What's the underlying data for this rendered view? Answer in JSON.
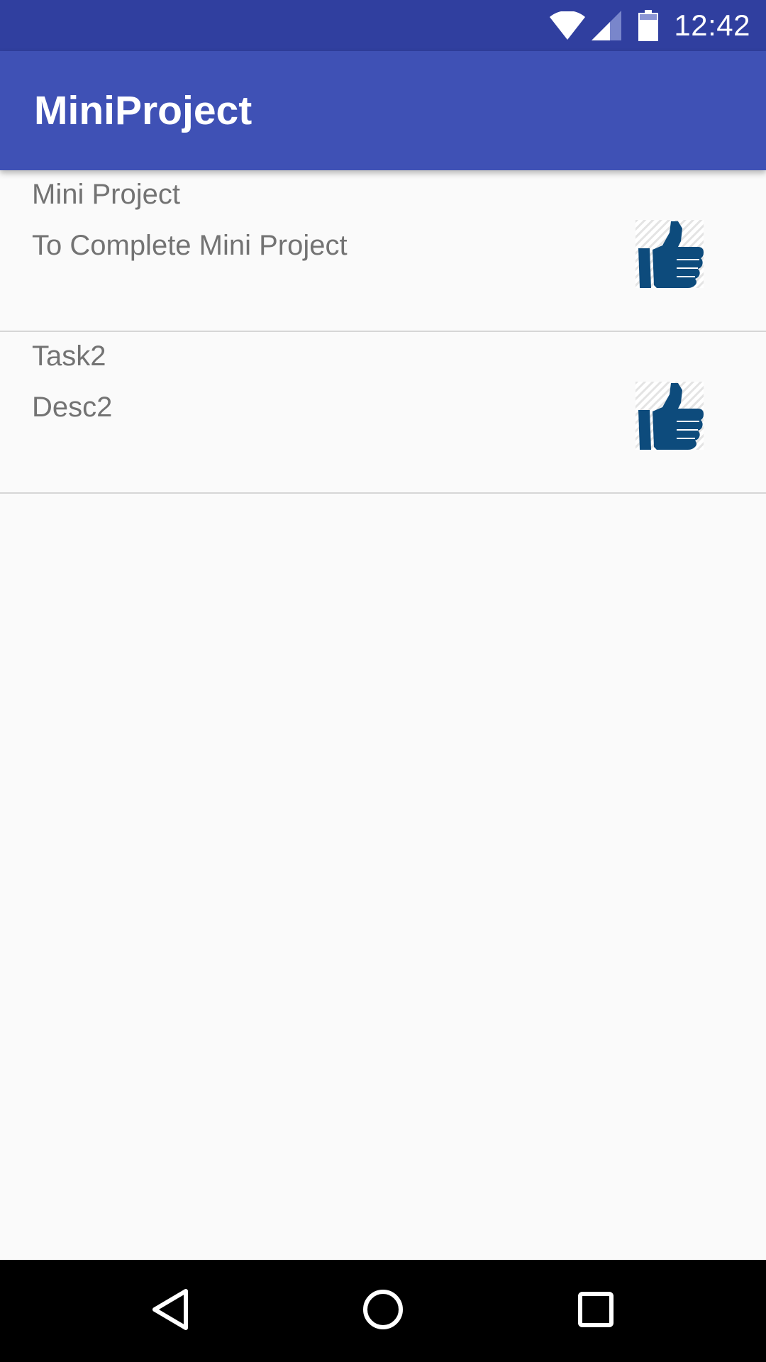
{
  "status_bar": {
    "time": "12:42",
    "icons": [
      "wifi-icon",
      "cell-signal-icon",
      "battery-icon"
    ]
  },
  "app_bar": {
    "title": "MiniProject"
  },
  "tasks": [
    {
      "title": "Mini Project",
      "description": "To Complete Mini Project",
      "action_icon": "thumbs-up-icon"
    },
    {
      "title": "Task2",
      "description": "Desc2",
      "action_icon": "thumbs-up-icon"
    }
  ],
  "nav_bar": {
    "buttons": [
      "back-icon",
      "home-icon",
      "recents-icon"
    ]
  },
  "colors": {
    "status_bar": "#303f9f",
    "app_bar": "#3f51b5",
    "background": "#fafafa",
    "text_secondary": "#737373",
    "thumbs_up": "#0d4b7c",
    "divider": "#d6d6d6"
  }
}
